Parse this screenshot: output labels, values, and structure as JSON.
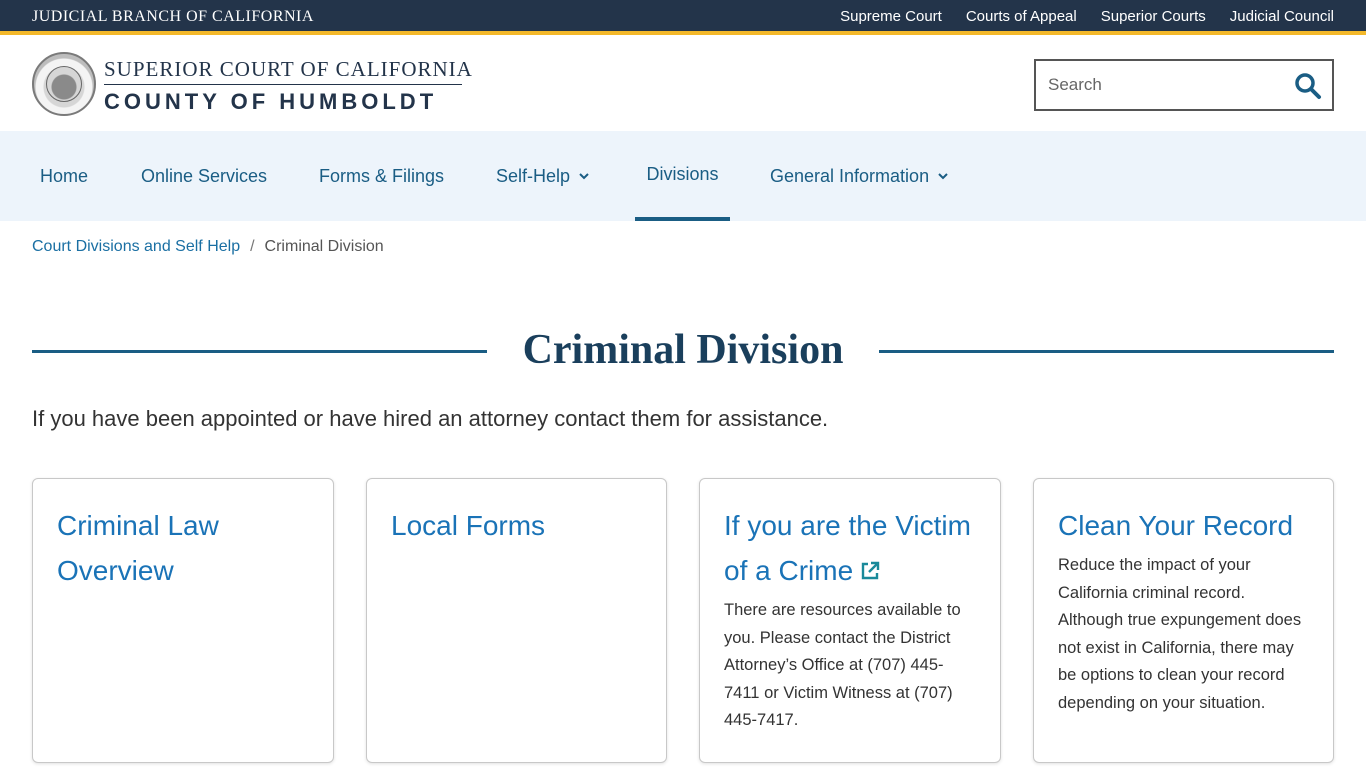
{
  "topbar": {
    "branch": "JUDICIAL BRANCH OF CALIFORNIA",
    "links": [
      "Supreme Court",
      "Courts of Appeal",
      "Superior Courts",
      "Judicial Council"
    ]
  },
  "header": {
    "title_line1": "SUPERIOR COURT OF CALIFORNIA",
    "title_line2": "COUNTY OF HUMBOLDT",
    "search_placeholder": "Search"
  },
  "nav": {
    "items": [
      {
        "label": "Home"
      },
      {
        "label": "Online Services"
      },
      {
        "label": "Forms & Filings"
      },
      {
        "label": "Self-Help"
      },
      {
        "label": "Divisions"
      },
      {
        "label": "General Information"
      }
    ]
  },
  "breadcrumb": {
    "parent": "Court Divisions and Self Help",
    "separator": "/",
    "current": "Criminal Division"
  },
  "page": {
    "title": "Criminal Division",
    "intro": "If you have been appointed or have hired an attorney contact them for assistance."
  },
  "cards": [
    {
      "title": "Criminal Law Overview",
      "body": ""
    },
    {
      "title": "Local Forms",
      "body": ""
    },
    {
      "title": "If you are the Victim of a Crime",
      "body": "There are resources available to you. Please contact the District Attorney’s Office at (707) 445-7411 or Victim Witness at (707) 445-7417."
    },
    {
      "title": "Clean Your Record",
      "body": "Reduce the impact of your California criminal record. Although true expungement does not exist in California, there may be options to clean your record depending on your situation."
    }
  ],
  "colors": {
    "topbar": "#23344a",
    "accent": "#f3b82a",
    "nav_bg": "#edf4fb",
    "link": "#1a73b7"
  },
  "icons": [
    "court-seal-icon",
    "search-icon",
    "chevron-down-icon",
    "external-link-icon"
  ]
}
